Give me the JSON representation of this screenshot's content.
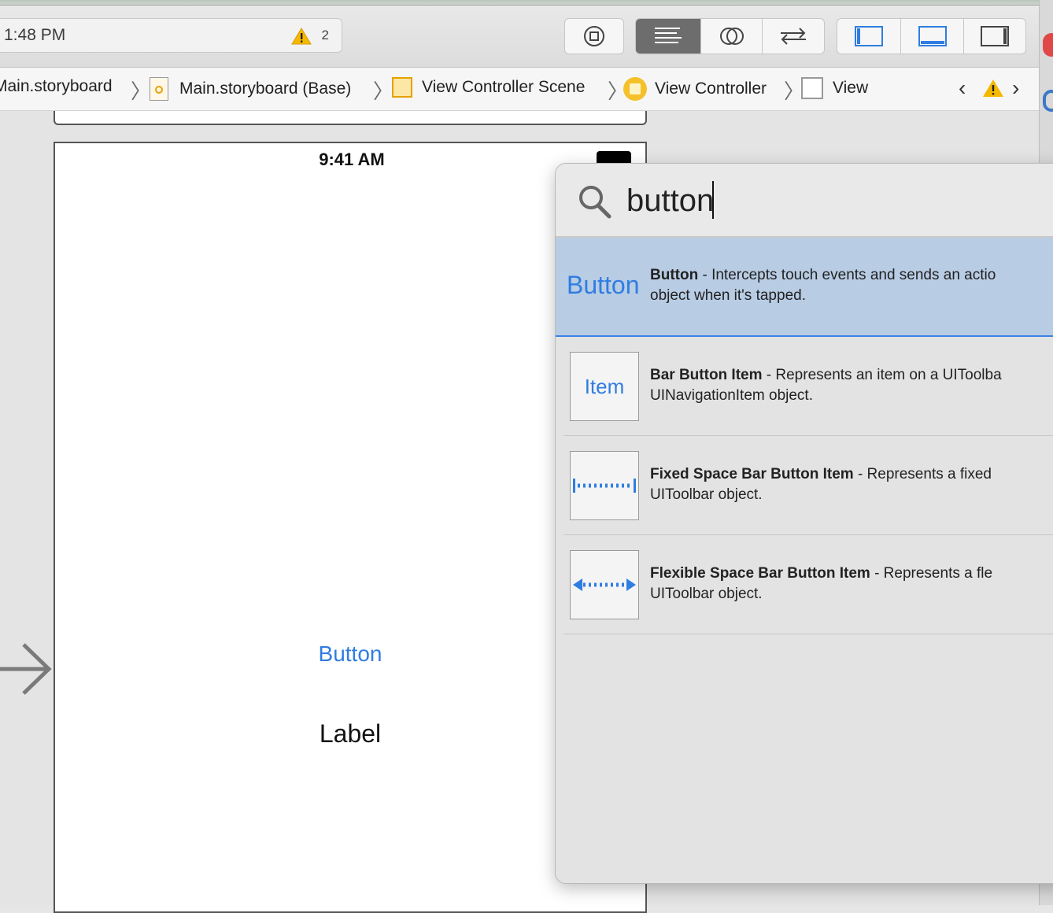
{
  "toolbar": {
    "activity_text": "1:48 PM",
    "warning_count": "2",
    "buttons": [
      "stop",
      "standard-editor",
      "assistant-editor",
      "version-editor",
      "navigator-toggle",
      "debug-toggle",
      "utilities-toggle"
    ]
  },
  "breadcrumb": {
    "items": [
      "Main.storyboard",
      "Main.storyboard (Base)",
      "View Controller Scene",
      "View Controller",
      "View"
    ]
  },
  "scene": {
    "status_time": "9:41 AM",
    "button_label": "Button",
    "label_text": "Label"
  },
  "library": {
    "search_value": "button",
    "results": [
      {
        "thumb_text": "Button",
        "title": "Button",
        "desc_line1": " - Intercepts touch events and sends an actio",
        "desc_line2": "object when it's tapped."
      },
      {
        "thumb_text": "Item",
        "title": "Bar Button Item",
        "desc_line1": " - Represents an item on a UIToolba",
        "desc_line2": "UINavigationItem object."
      },
      {
        "thumb_text": "",
        "title": "Fixed Space Bar Button Item",
        "desc_line1": " - Represents a fixed",
        "desc_line2": "UIToolbar object."
      },
      {
        "thumb_text": "",
        "title": "Flexible Space Bar Button Item",
        "desc_line1": " - Represents a fle",
        "desc_line2": "UIToolbar object."
      }
    ]
  },
  "colors": {
    "accent": "#2f7de1",
    "selection": "#b8cce4",
    "warning": "#f5b800"
  }
}
